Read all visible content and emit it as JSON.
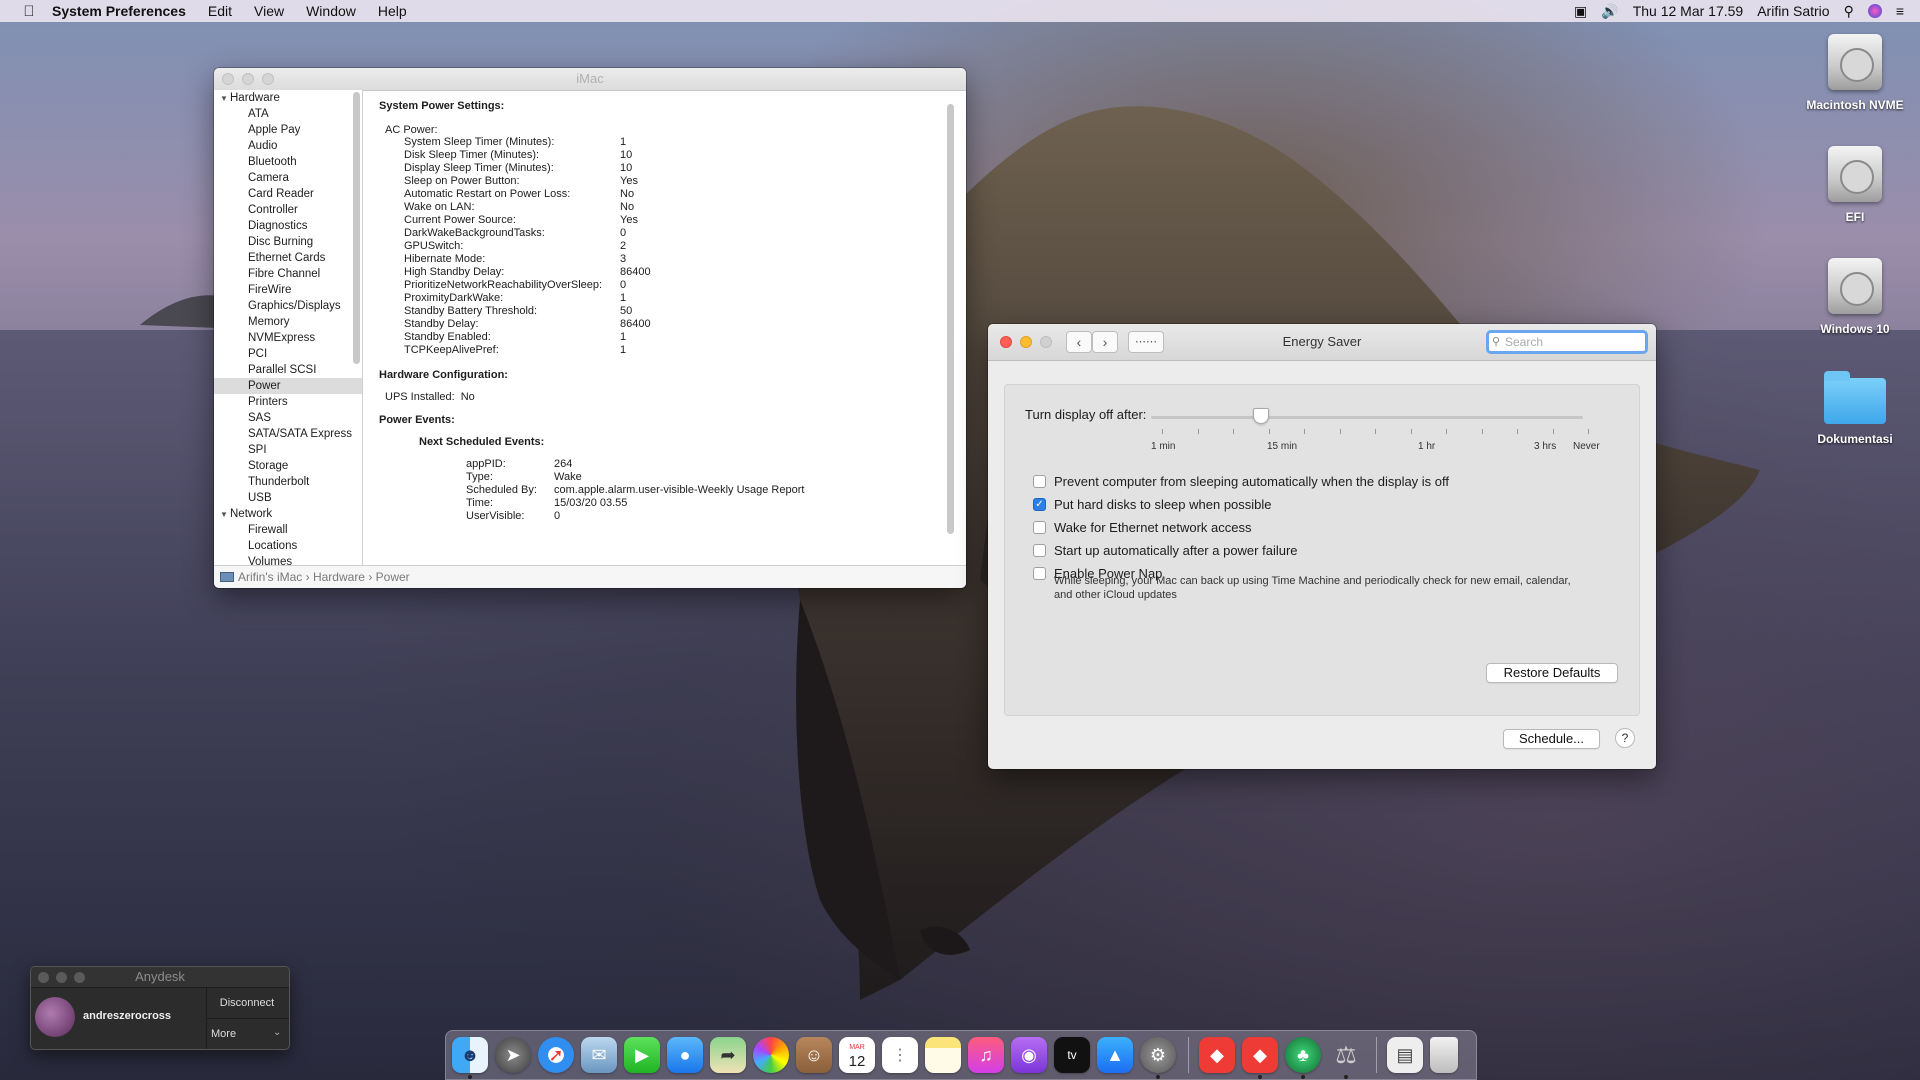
{
  "menubar": {
    "app_name": "System Preferences",
    "menus": [
      "Edit",
      "View",
      "Window",
      "Help"
    ],
    "datetime": "Thu 12 Mar  17.59",
    "user": "Arifin Satrio"
  },
  "desktop_icons": [
    {
      "label": "Macintosh NVME",
      "kind": "disk"
    },
    {
      "label": "EFI",
      "kind": "disk"
    },
    {
      "label": "Windows 10",
      "kind": "disk"
    },
    {
      "label": "Dokumentasi",
      "kind": "folder"
    }
  ],
  "sysinfo": {
    "title": "iMac",
    "sidebar": {
      "group_hardware": "Hardware",
      "hardware_items": [
        "ATA",
        "Apple Pay",
        "Audio",
        "Bluetooth",
        "Camera",
        "Card Reader",
        "Controller",
        "Diagnostics",
        "Disc Burning",
        "Ethernet Cards",
        "Fibre Channel",
        "FireWire",
        "Graphics/Displays",
        "Memory",
        "NVMExpress",
        "PCI",
        "Parallel SCSI",
        "Power",
        "Printers",
        "SAS",
        "SATA/SATA Express",
        "SPI",
        "Storage",
        "Thunderbolt",
        "USB"
      ],
      "selected": "Power",
      "group_network": "Network",
      "network_items": [
        "Firewall",
        "Locations",
        "Volumes"
      ]
    },
    "heading_power": "System Power Settings:",
    "ac_power": "AC Power:",
    "settings": [
      {
        "k": "System Sleep Timer (Minutes):",
        "v": "1"
      },
      {
        "k": "Disk Sleep Timer (Minutes):",
        "v": "10"
      },
      {
        "k": "Display Sleep Timer (Minutes):",
        "v": "10"
      },
      {
        "k": "Sleep on Power Button:",
        "v": "Yes"
      },
      {
        "k": "Automatic Restart on Power Loss:",
        "v": "No"
      },
      {
        "k": "Wake on LAN:",
        "v": "No"
      },
      {
        "k": "Current Power Source:",
        "v": "Yes"
      },
      {
        "k": "DarkWakeBackgroundTasks:",
        "v": "0"
      },
      {
        "k": "GPUSwitch:",
        "v": "2"
      },
      {
        "k": "Hibernate Mode:",
        "v": "3"
      },
      {
        "k": "High Standby Delay:",
        "v": "86400"
      },
      {
        "k": "PrioritizeNetworkReachabilityOverSleep:",
        "v": "0"
      },
      {
        "k": "ProximityDarkWake:",
        "v": "1"
      },
      {
        "k": "Standby Battery Threshold:",
        "v": "50"
      },
      {
        "k": "Standby Delay:",
        "v": "86400"
      },
      {
        "k": "Standby Enabled:",
        "v": "1"
      },
      {
        "k": "TCPKeepAlivePref:",
        "v": "1"
      }
    ],
    "heading_hw": "Hardware Configuration:",
    "ups_label": "UPS Installed:",
    "ups_value": "No",
    "heading_events": "Power Events:",
    "heading_next": "Next Scheduled Events:",
    "events": [
      {
        "k": "appPID:",
        "v": "264"
      },
      {
        "k": "Type:",
        "v": "Wake"
      },
      {
        "k": "Scheduled By:",
        "v": "com.apple.alarm.user-visible-Weekly Usage Report"
      },
      {
        "k": "Time:",
        "v": "15/03/20 03.55"
      },
      {
        "k": "UserVisible:",
        "v": "0"
      }
    ],
    "breadcrumb": "Arifin's iMac › Hardware › Power"
  },
  "energy": {
    "title": "Energy Saver",
    "search_placeholder": "Search",
    "slider_label": "Turn display off after:",
    "slider_ticks": [
      "1 min",
      "15 min",
      "1 hr",
      "3 hrs",
      "Never"
    ],
    "slider_value": "15 min",
    "options": [
      {
        "label": "Prevent computer from sleeping automatically when the display is off",
        "checked": false
      },
      {
        "label": "Put hard disks to sleep when possible",
        "checked": true
      },
      {
        "label": "Wake for Ethernet network access",
        "checked": false
      },
      {
        "label": "Start up automatically after a power failure",
        "checked": false
      },
      {
        "label": "Enable Power Nap",
        "checked": false
      }
    ],
    "powernap_desc": "While sleeping, your Mac can back up using Time Machine and periodically check for new email, calendar, and other iCloud updates",
    "restore_label": "Restore Defaults",
    "schedule_label": "Schedule...",
    "help_label": "?"
  },
  "anydesk": {
    "title": "Anydesk",
    "user": "andreszerocross",
    "disconnect": "Disconnect",
    "more": "More"
  },
  "dock": {
    "calendar_day": "12",
    "calendar_month": "MAR"
  }
}
